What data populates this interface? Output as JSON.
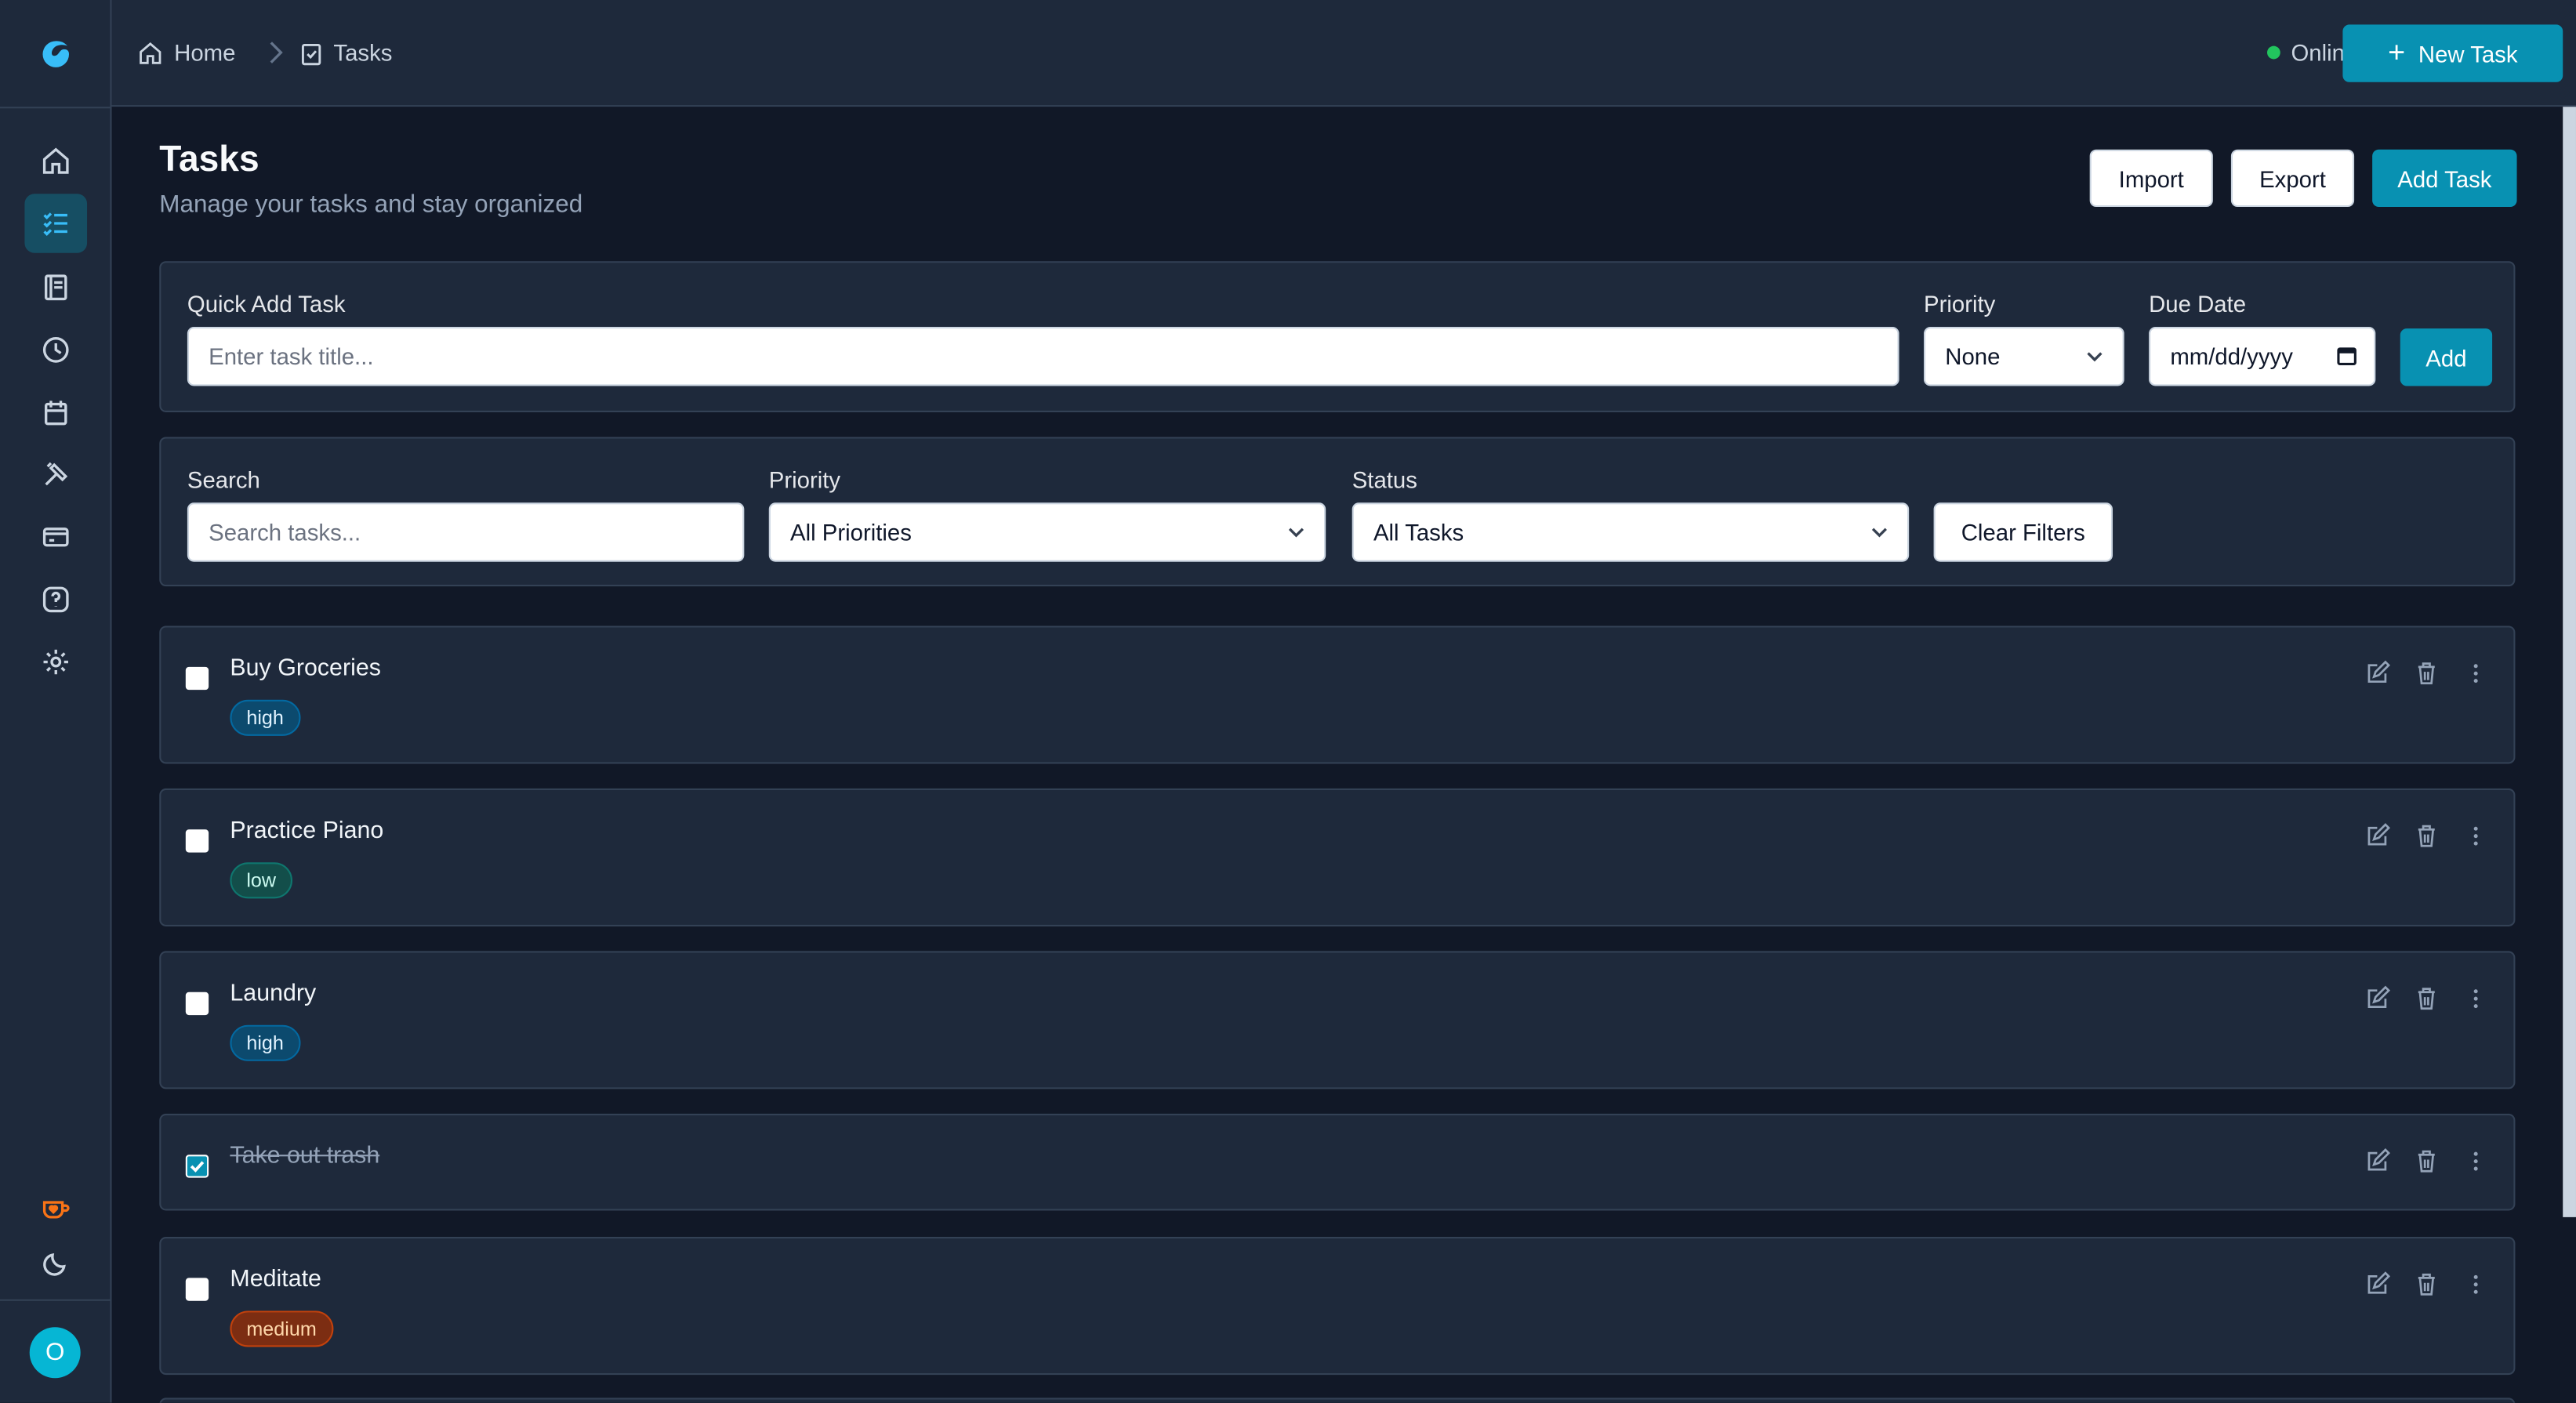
{
  "breadcrumb": {
    "home": "Home",
    "current": "Tasks"
  },
  "header": {
    "status": "Online",
    "new_task": "New Task"
  },
  "page": {
    "title": "Tasks",
    "subtitle": "Manage your tasks and stay organized",
    "import": "Import",
    "export": "Export",
    "add_task": "Add Task"
  },
  "quick_add": {
    "label": "Quick Add Task",
    "placeholder": "Enter task title...",
    "priority_label": "Priority",
    "priority_value": "None",
    "due_label": "Due Date",
    "due_placeholder": "mm/dd/yyyy",
    "add": "Add"
  },
  "filters": {
    "search_label": "Search",
    "search_placeholder": "Search tasks...",
    "priority_label": "Priority",
    "priority_value": "All Priorities",
    "status_label": "Status",
    "status_value": "All Tasks",
    "clear": "Clear Filters"
  },
  "tasks": [
    {
      "title": "Buy Groceries",
      "priority": "high",
      "done": false
    },
    {
      "title": "Practice Piano",
      "priority": "low",
      "done": false
    },
    {
      "title": "Laundry",
      "priority": "high",
      "done": false
    },
    {
      "title": "Take out trash",
      "priority": "",
      "done": true
    },
    {
      "title": "Meditate",
      "priority": "medium",
      "done": false
    }
  ],
  "user": {
    "initial": "O"
  },
  "colors": {
    "accent": "#0891b2",
    "bg": "#111827",
    "panel": "#1e293b",
    "online": "#22c55e"
  }
}
